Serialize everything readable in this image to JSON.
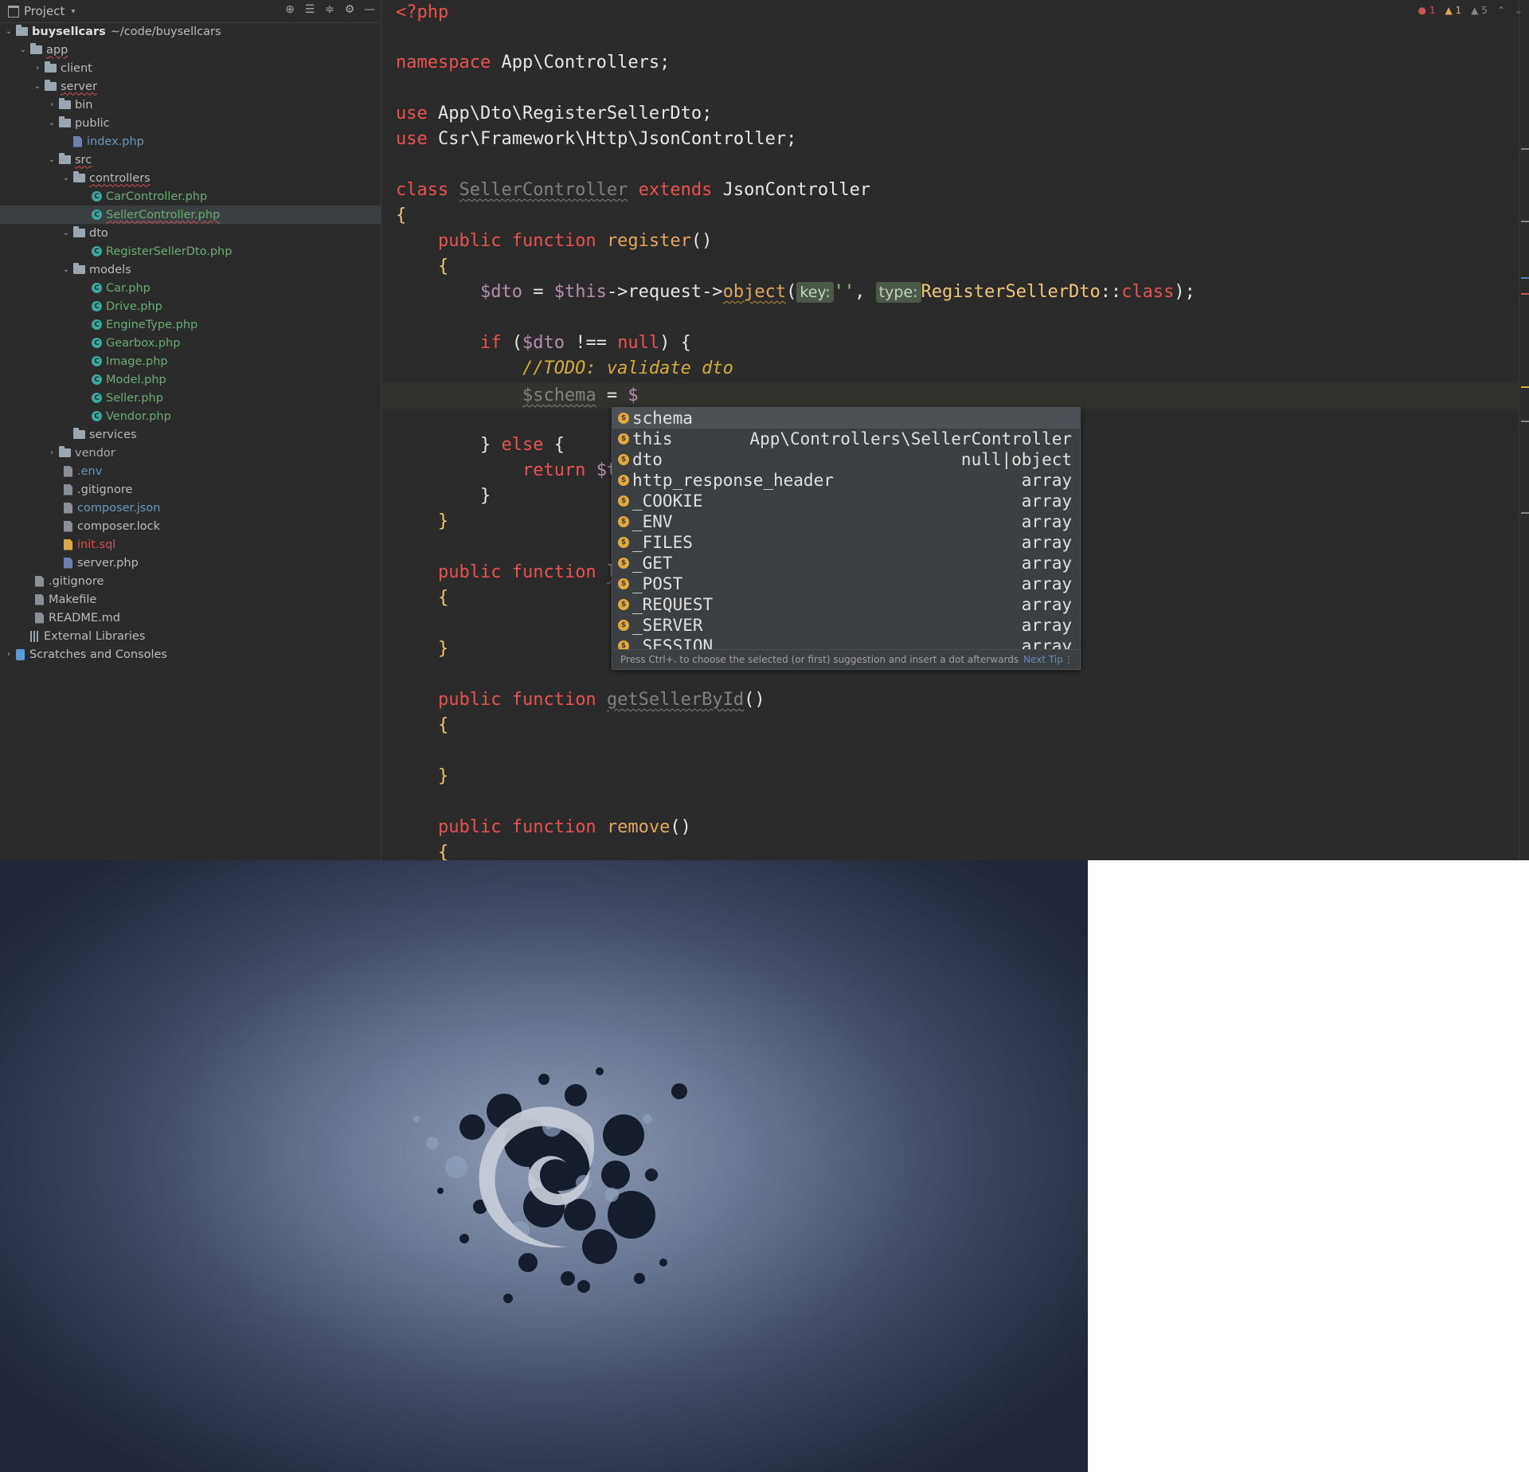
{
  "project_panel": {
    "title": "Project",
    "tree": [
      {
        "label": "buysellcars",
        "path": "~/code/buysellcars",
        "type": "folder",
        "open": true
      },
      {
        "label": "app",
        "type": "folder",
        "open": true
      },
      {
        "label": "client",
        "type": "folder",
        "open": false
      },
      {
        "label": "server",
        "type": "folder",
        "open": true
      },
      {
        "label": "bin",
        "type": "folder",
        "open": false
      },
      {
        "label": "public",
        "type": "folder",
        "open": true
      },
      {
        "label": "index.php",
        "type": "php"
      },
      {
        "label": "src",
        "type": "folder",
        "open": true
      },
      {
        "label": "controllers",
        "type": "folder",
        "open": true
      },
      {
        "label": "CarController.php",
        "type": "class"
      },
      {
        "label": "SellerController.php",
        "type": "class",
        "selected": true
      },
      {
        "label": "dto",
        "type": "folder",
        "open": true
      },
      {
        "label": "RegisterSellerDto.php",
        "type": "class"
      },
      {
        "label": "models",
        "type": "folder",
        "open": true
      },
      {
        "label": "Car.php",
        "type": "class"
      },
      {
        "label": "Drive.php",
        "type": "class"
      },
      {
        "label": "EngineType.php",
        "type": "class"
      },
      {
        "label": "Gearbox.php",
        "type": "class"
      },
      {
        "label": "Image.php",
        "type": "class"
      },
      {
        "label": "Model.php",
        "type": "class"
      },
      {
        "label": "Seller.php",
        "type": "class"
      },
      {
        "label": "Vendor.php",
        "type": "class"
      },
      {
        "label": "services",
        "type": "folder"
      },
      {
        "label": "vendor",
        "type": "folder",
        "open": false
      },
      {
        "label": ".env",
        "type": "file"
      },
      {
        "label": ".gitignore",
        "type": "file"
      },
      {
        "label": "composer.json",
        "type": "file"
      },
      {
        "label": "composer.lock",
        "type": "file"
      },
      {
        "label": "init.sql",
        "type": "sql"
      },
      {
        "label": "server.php",
        "type": "php"
      },
      {
        "label": ".gitignore",
        "type": "file"
      },
      {
        "label": "Makefile",
        "type": "file"
      },
      {
        "label": "README.md",
        "type": "file"
      },
      {
        "label": "External Libraries",
        "type": "lib"
      },
      {
        "label": "Scratches and Consoles",
        "type": "scratch"
      }
    ]
  },
  "editor": {
    "inspections": {
      "errors": "1",
      "warnings": "1",
      "weak_warnings": "5"
    },
    "code": {
      "open_tag": "<?php",
      "ns_kw": "namespace",
      "ns": "App\\Controllers;",
      "use_kw": "use",
      "use1": "App\\Dto\\RegisterSellerDto;",
      "use2": "Csr\\Framework\\Http\\JsonController;",
      "class_kw": "class",
      "class_name": "SellerController",
      "extends_kw": "extends",
      "parent": "JsonController",
      "brace_open": "{",
      "brace_close": "}",
      "public_kw": "public",
      "function_kw": "function",
      "fn_register": "register",
      "parens": "()",
      "dto_var": "$dto",
      "assign": " = ",
      "this_var": "$this",
      "arrow_request": "->request->",
      "fn_object": "object",
      "paren_open": "(",
      "hint_key": "key:",
      "empty_str": "''",
      "comma": ", ",
      "hint_type": "type:",
      "dto_class": "RegisterSellerDto",
      "dcolon": "::",
      "class_const": "class",
      "paren_close_semi": ");",
      "if_kw": "if",
      "if_cond_open": " (",
      "null_kw": "null",
      "neq": " !== ",
      "if_cond_close": ") {",
      "todo": "//TODO: validate dto",
      "schema_var": "$schema",
      "schema_assign": " = ",
      "dollar": "$",
      "else_kw": "else",
      "return_kw": "return",
      "return_partial": "$t",
      "fn_partial": "l",
      "fn_getSellerById": "getSellerById",
      "fn_remove": "remove"
    }
  },
  "completion": {
    "items": [
      {
        "name": "schema",
        "type": ""
      },
      {
        "name": "this",
        "type": "App\\Controllers\\SellerController"
      },
      {
        "name": "dto",
        "type": "null|object"
      },
      {
        "name": "http_response_header",
        "type": "array"
      },
      {
        "name": "_COOKIE",
        "type": "array"
      },
      {
        "name": "_ENV",
        "type": "array"
      },
      {
        "name": "_FILES",
        "type": "array"
      },
      {
        "name": "_GET",
        "type": "array"
      },
      {
        "name": "_POST",
        "type": "array"
      },
      {
        "name": "_REQUEST",
        "type": "array"
      },
      {
        "name": "_SERVER",
        "type": "array"
      },
      {
        "name": "_SESSION",
        "type": "array"
      }
    ],
    "footer_text": "Press Ctrl+. to choose the selected (or first) suggestion and insert a dot afterwards",
    "footer_link": "Next Tip"
  },
  "colors": {
    "accent": "#e8524f",
    "background": "#2b2b2b",
    "popup": "#3c3f41"
  }
}
